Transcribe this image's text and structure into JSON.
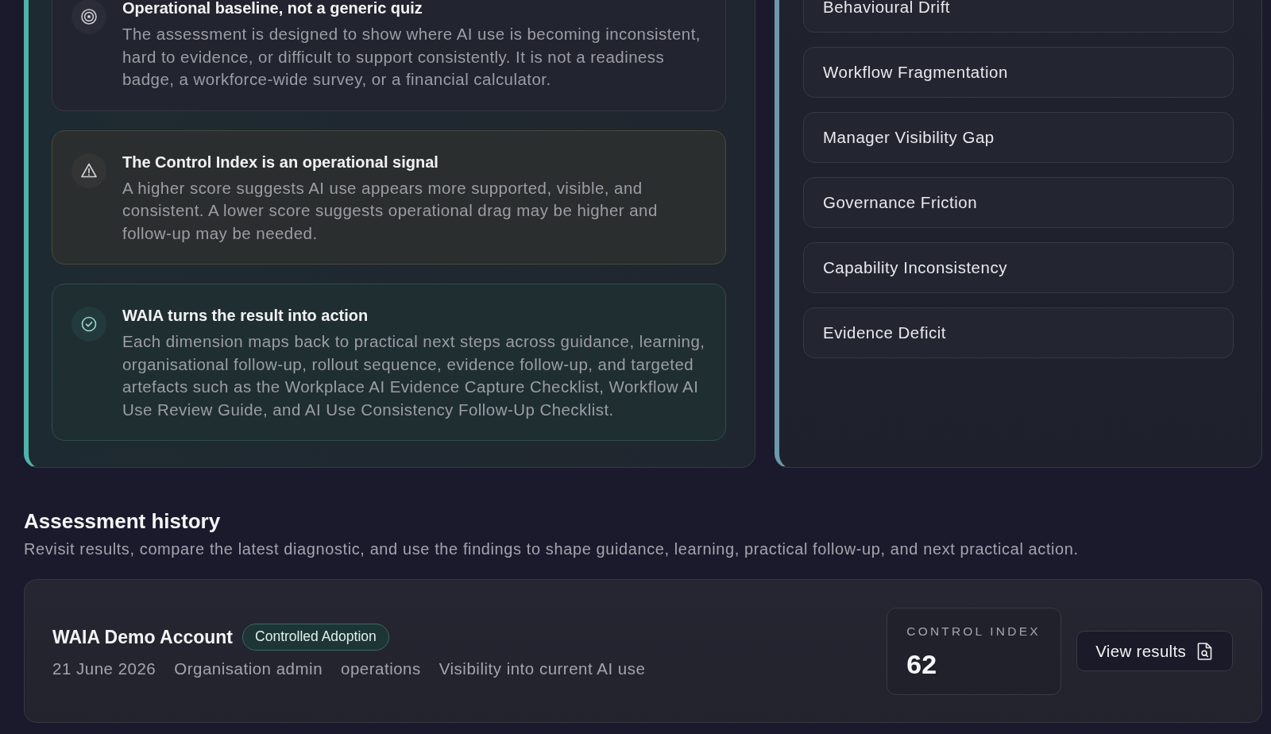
{
  "overview_panel": {
    "notes": [
      {
        "kind": "target",
        "title": "Operational baseline, not a generic quiz",
        "body": "The assessment is designed to show where AI use is becoming inconsistent, hard to evidence, or difficult to support consistently. It is not a readiness badge, a workforce-wide survey, or a financial calculator."
      },
      {
        "kind": "warning",
        "title": "The Control Index is an operational signal",
        "body": "A higher score suggests AI use appears more supported, visible, and consistent. A lower score suggests operational drag may be higher and follow-up may be needed."
      },
      {
        "kind": "check",
        "title": "WAIA turns the result into action",
        "body": "Each dimension maps back to practical next steps across guidance, learning, organisational follow-up, rollout sequence, evidence follow-up, and targeted artefacts such as the Workplace AI Evidence Capture Checklist, Workflow AI Use Review Guide, and AI Use Consistency Follow-Up Checklist."
      }
    ]
  },
  "dimensions_panel": {
    "items": [
      "Behavioural Drift",
      "Workflow Fragmentation",
      "Manager Visibility Gap",
      "Governance Friction",
      "Capability Inconsistency",
      "Evidence Deficit"
    ]
  },
  "assessment_history": {
    "title": "Assessment history",
    "description": "Revisit results, compare the latest diagnostic, and use the findings to shape guidance, learning, practical follow-up, and next practical action.",
    "entries": [
      {
        "account": "WAIA Demo Account",
        "band": "Controlled Adoption",
        "details": [
          "21 June 2026",
          "Organisation admin",
          "operations",
          "Visibility into current AI use"
        ],
        "score_label": "CONTROL INDEX",
        "score": "62",
        "action": "View results"
      }
    ]
  }
}
